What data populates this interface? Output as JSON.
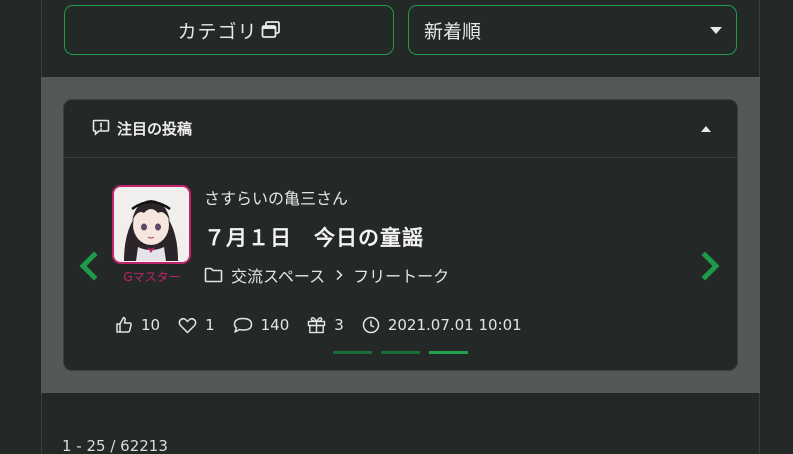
{
  "controls": {
    "category_label": "カテゴリ",
    "sort_value": "新着順"
  },
  "featured": {
    "heading": "注目の投稿",
    "post": {
      "author": "さすらいの亀三さん",
      "rank": "Gマスター",
      "title": "７月１日　今日の童謡",
      "category": "交流スペース",
      "subcategory": "フリートーク",
      "likes": "10",
      "favorites": "1",
      "comments": "140",
      "gifts": "3",
      "posted_at": "2021.07.01 10:01"
    },
    "carousel_active_index": 3,
    "carousel_total": 3
  },
  "results": {
    "range_text": "1 - 25 / 62213"
  },
  "colors": {
    "accent": "#1fa24d",
    "rank": "#c0246a",
    "background": "#242827",
    "band": "#535a56"
  }
}
